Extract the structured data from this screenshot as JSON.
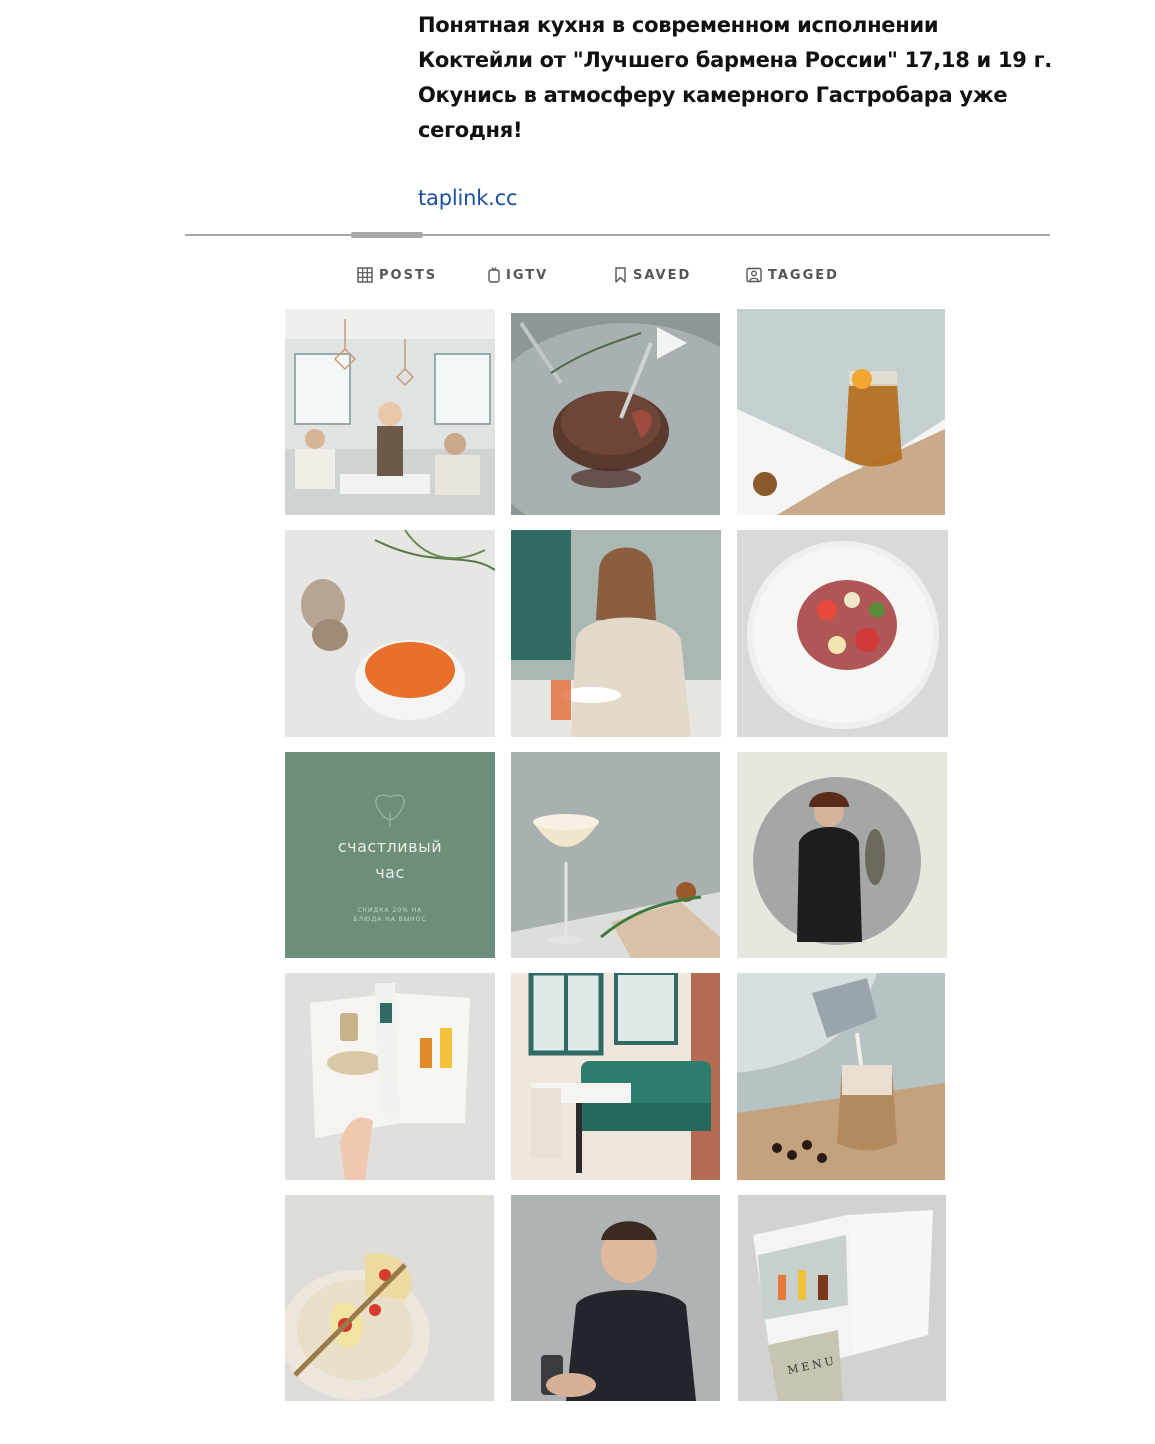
{
  "profile": {
    "bio_lines": [
      "Понятная кухня в современном исполнении",
      "Коктейли от \"Лучшего бармена России\" 17,18 и 19 г.",
      "Окунись в атмосферу камерного Гастробара уже",
      "сегодня!"
    ],
    "link": "taplink.cc"
  },
  "tabs": [
    {
      "label": "POSTS",
      "icon": "grid-icon",
      "active": true
    },
    {
      "label": "IGTV",
      "icon": "igtv-icon",
      "active": false
    },
    {
      "label": "SAVED",
      "icon": "bookmark-icon",
      "active": false
    },
    {
      "label": "TAGGED",
      "icon": "tagged-icon",
      "active": false
    }
  ],
  "posts": [
    {
      "subject": "restaurant interior with waitress and guests"
    },
    {
      "subject": "steak on plate with fork",
      "video": true
    },
    {
      "subject": "amber cocktail in carafe"
    },
    {
      "subject": "creamy soup bowl with mushroom"
    },
    {
      "subject": "woman eating in restaurant"
    },
    {
      "subject": "salad on speckled plate"
    },
    {
      "subject": "happy hour promo card",
      "text_title": "счастливый\nчас",
      "text_sub": "СКИДКА 20% НА\nБЛЮДА НА ВЫНОС",
      "bg": "#6d8e7a"
    },
    {
      "subject": "creamy cocktail in coupe glass"
    },
    {
      "subject": "chef holding fish in circle"
    },
    {
      "subject": "open menu booklet with hand"
    },
    {
      "subject": "teal booth seating interior"
    },
    {
      "subject": "pouring milk into coffee"
    },
    {
      "subject": "pasta on fork above bowl"
    },
    {
      "subject": "bartender with shaker"
    },
    {
      "subject": "menu booklet with cocktails",
      "text_title": "MENU"
    }
  ],
  "colors": {
    "link": "#1b4fa3",
    "tab_text": "#555555",
    "divider": "#a8a8a8",
    "happy_hour_bg": "#6d8e7a"
  }
}
